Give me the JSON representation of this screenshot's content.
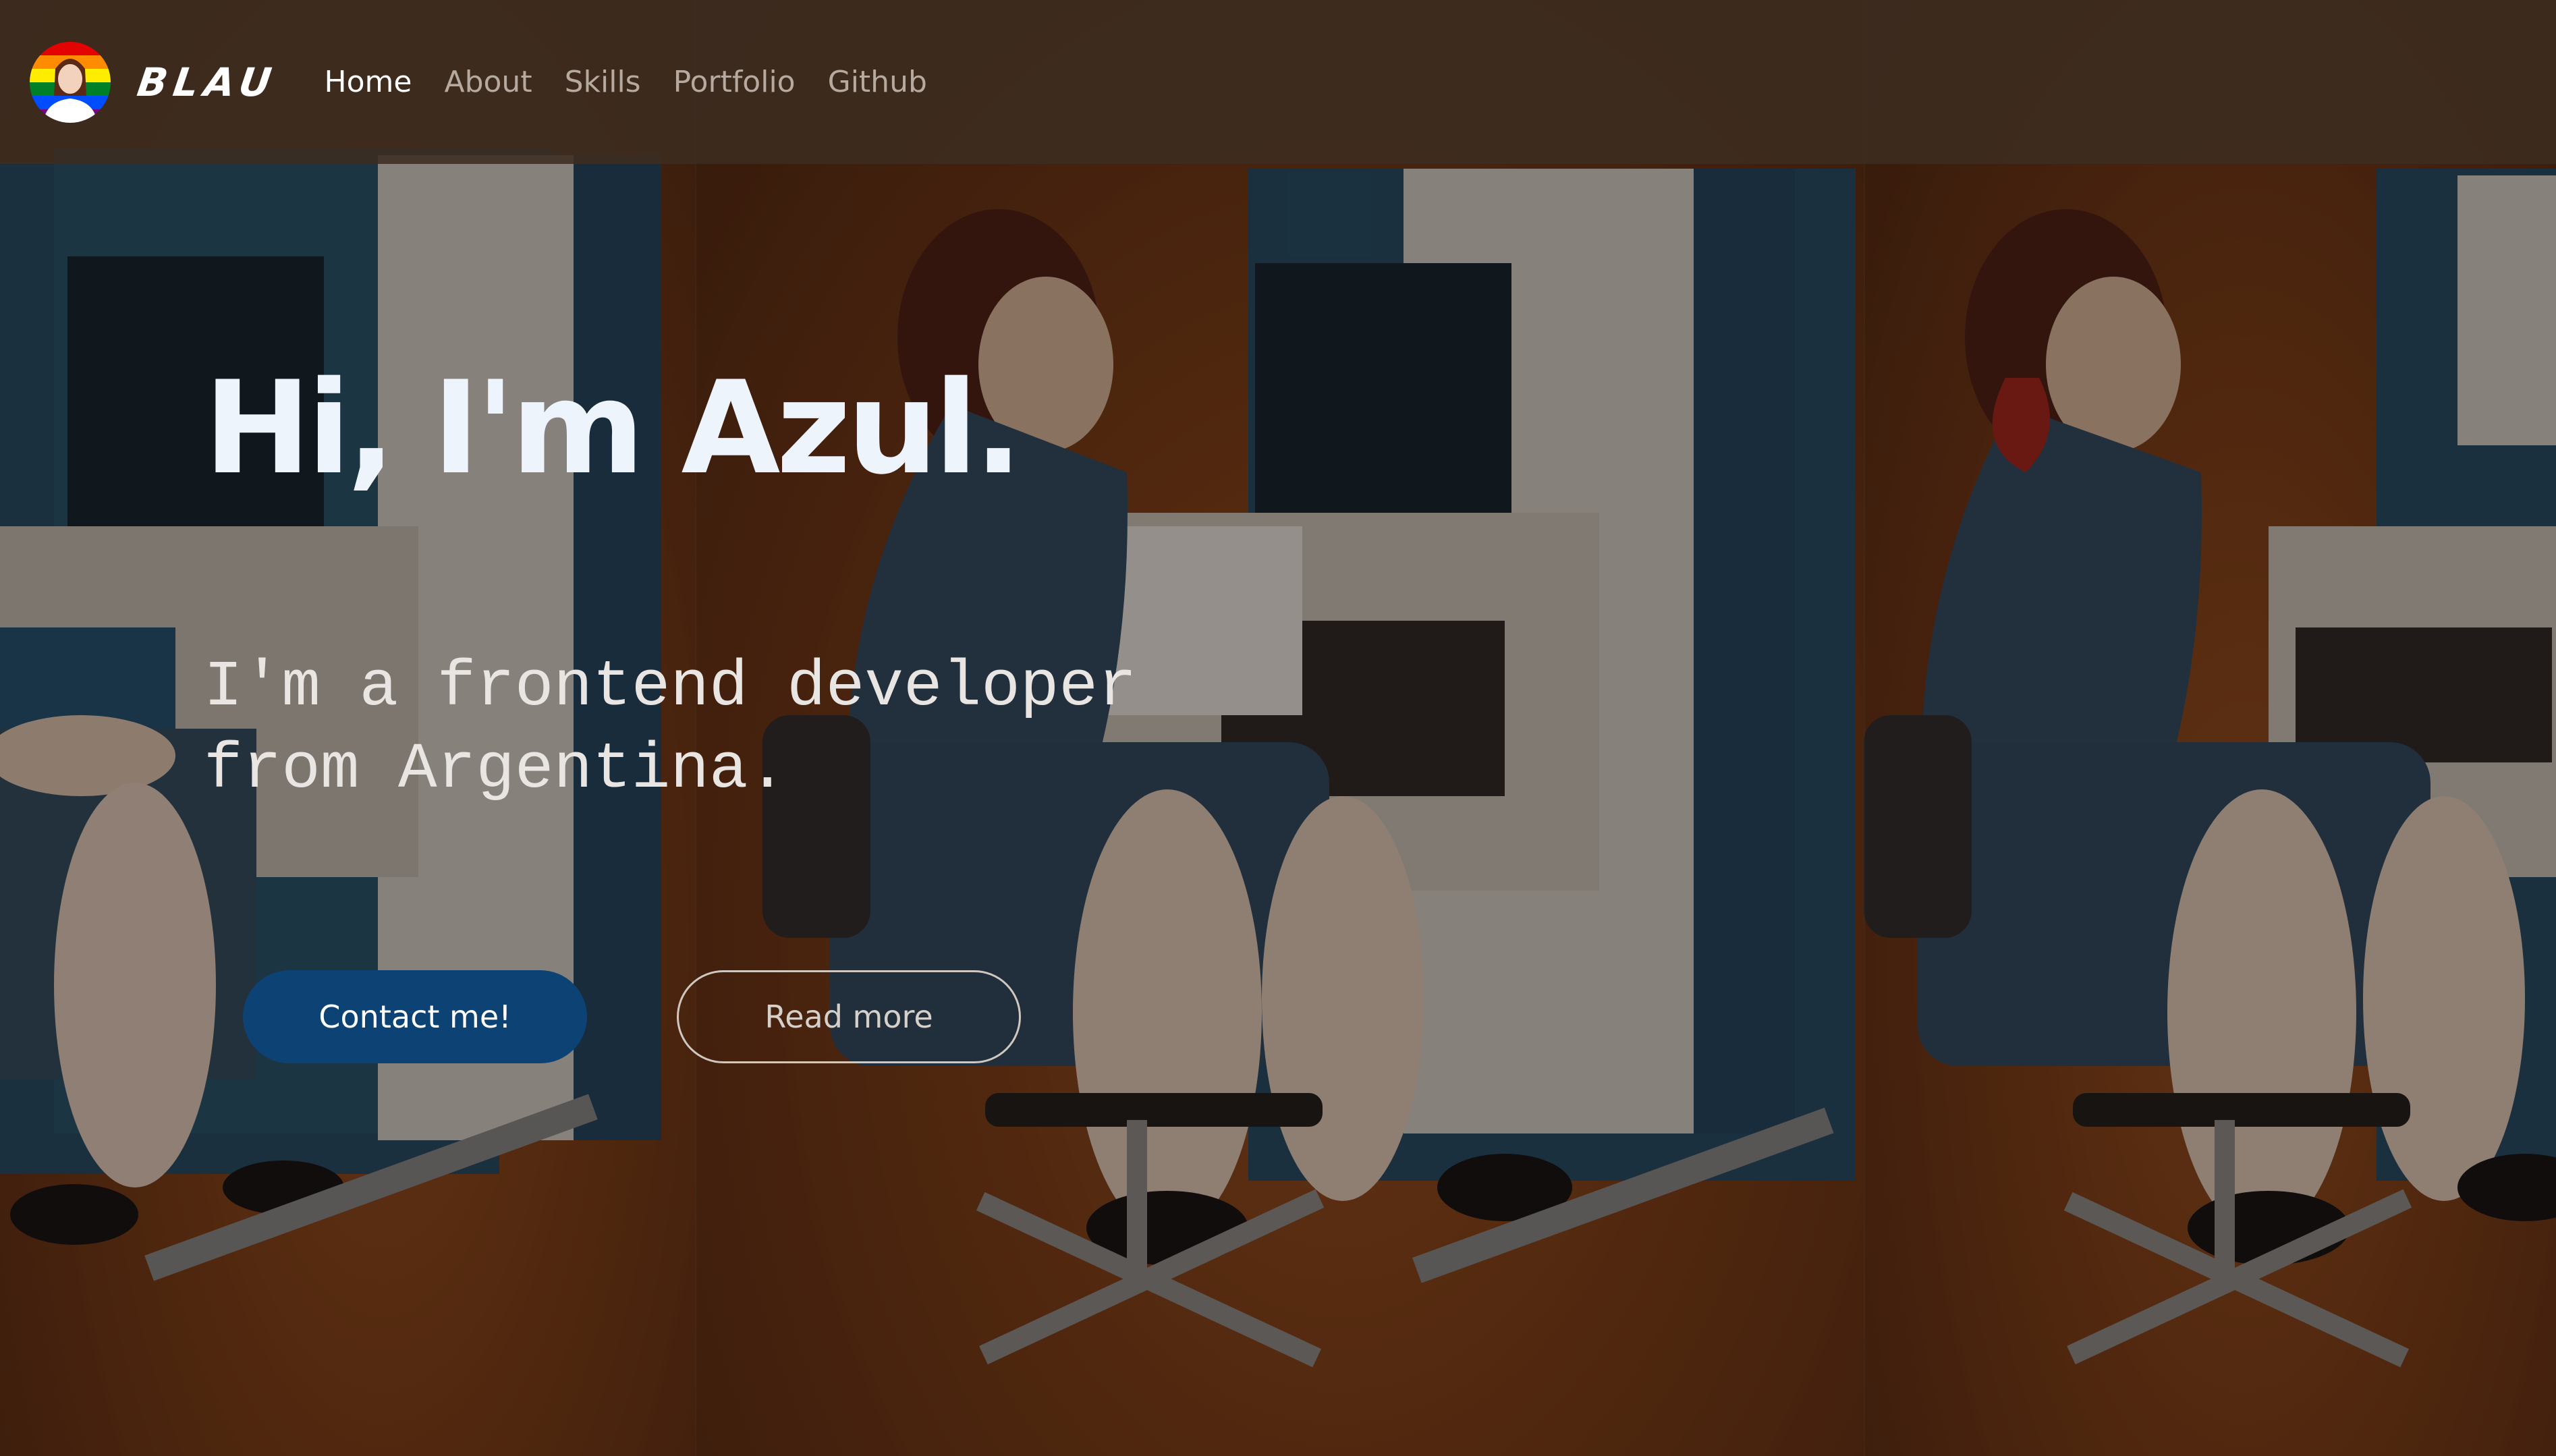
{
  "brand": {
    "name": "BLAU"
  },
  "nav": {
    "items": [
      {
        "label": "Home",
        "active": true
      },
      {
        "label": "About",
        "active": false
      },
      {
        "label": "Skills",
        "active": false
      },
      {
        "label": "Portfolio",
        "active": false
      },
      {
        "label": "Github",
        "active": false
      }
    ]
  },
  "hero": {
    "title": "Hi, I'm Azul.",
    "subtitle_line1": "I'm a frontend developer",
    "subtitle_line2": "from Argentina.",
    "primary_button": "Contact me!",
    "secondary_button": "Read more"
  },
  "colors": {
    "navbar": "#3c2c20",
    "primary_button": "#0d4275",
    "title_text": "#eef4fb",
    "nav_inactive": "#b6aaa0"
  }
}
